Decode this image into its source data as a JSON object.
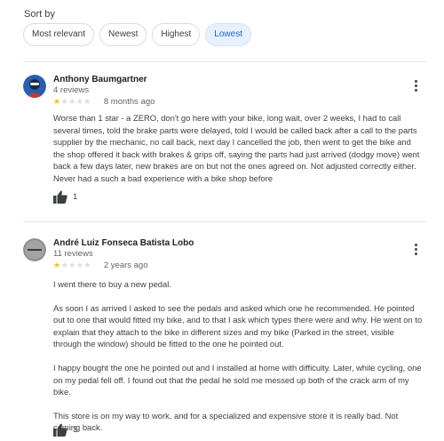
{
  "sort": {
    "label": "Sort by",
    "options": [
      "Most relevant",
      "Newest",
      "Highest",
      "Lowest"
    ],
    "selected": "Lowest"
  },
  "colors": {
    "star_filled": "#fbbc04",
    "star_empty": "#dadce0",
    "chip_active_bg": "#e8f0fe",
    "chip_active_text": "#1967d2"
  },
  "reviews": [
    {
      "author": "Anthony Baumgartner",
      "count": "4 reviews",
      "rating": 1,
      "time": "8 months ago",
      "paragraphs": [
        "Worse than 1 star - a ZERO, don't go here with your bike, long wait, over 2 weeks, I had to call several times, told the brake parts were delayed, told I would be called back after a call to the parts supplier by the mechanic, no call back, next day I cancelled the job, then went to get the bike and the shop offered it back with brakes & grips off, saying the parts had just arrived (dodgy move) went back a few days later, new brakes are on but not the ones agreed on. Not adjusted correctly either. Never had a such a bad experience with a bike shop before"
      ],
      "likes": "1",
      "avatar_icon": "avatar-photo"
    },
    {
      "author": "André Luiz Fonseca Batista Lobo",
      "count": "11 reviews",
      "rating": 1,
      "time": "2 years ago",
      "paragraphs": [
        "I went there to buy a new pedal.",
        "As soon I as arrived I asked to see the pedals and asked which one he recommended. He pointed out to one  that would fitted my bike,  and to that I ask which types there were and why. He went on to explain that they attach to the bike in different sizes and my bike (Parked in the street, visible through the window) should be fitted to the one he pointed out.",
        "I happy bought the one he pointed out and I installed at home with difficulty. Later, while cycling, one on my pedal fell off. I found out that the pedal he sold me messed up both of the crack arm of my bike.",
        "This store is on my way to work, and for a specialized and expensive store it is really bad. Not coming back."
      ],
      "likes": "3",
      "avatar_icon": "avatar-logo"
    }
  ]
}
